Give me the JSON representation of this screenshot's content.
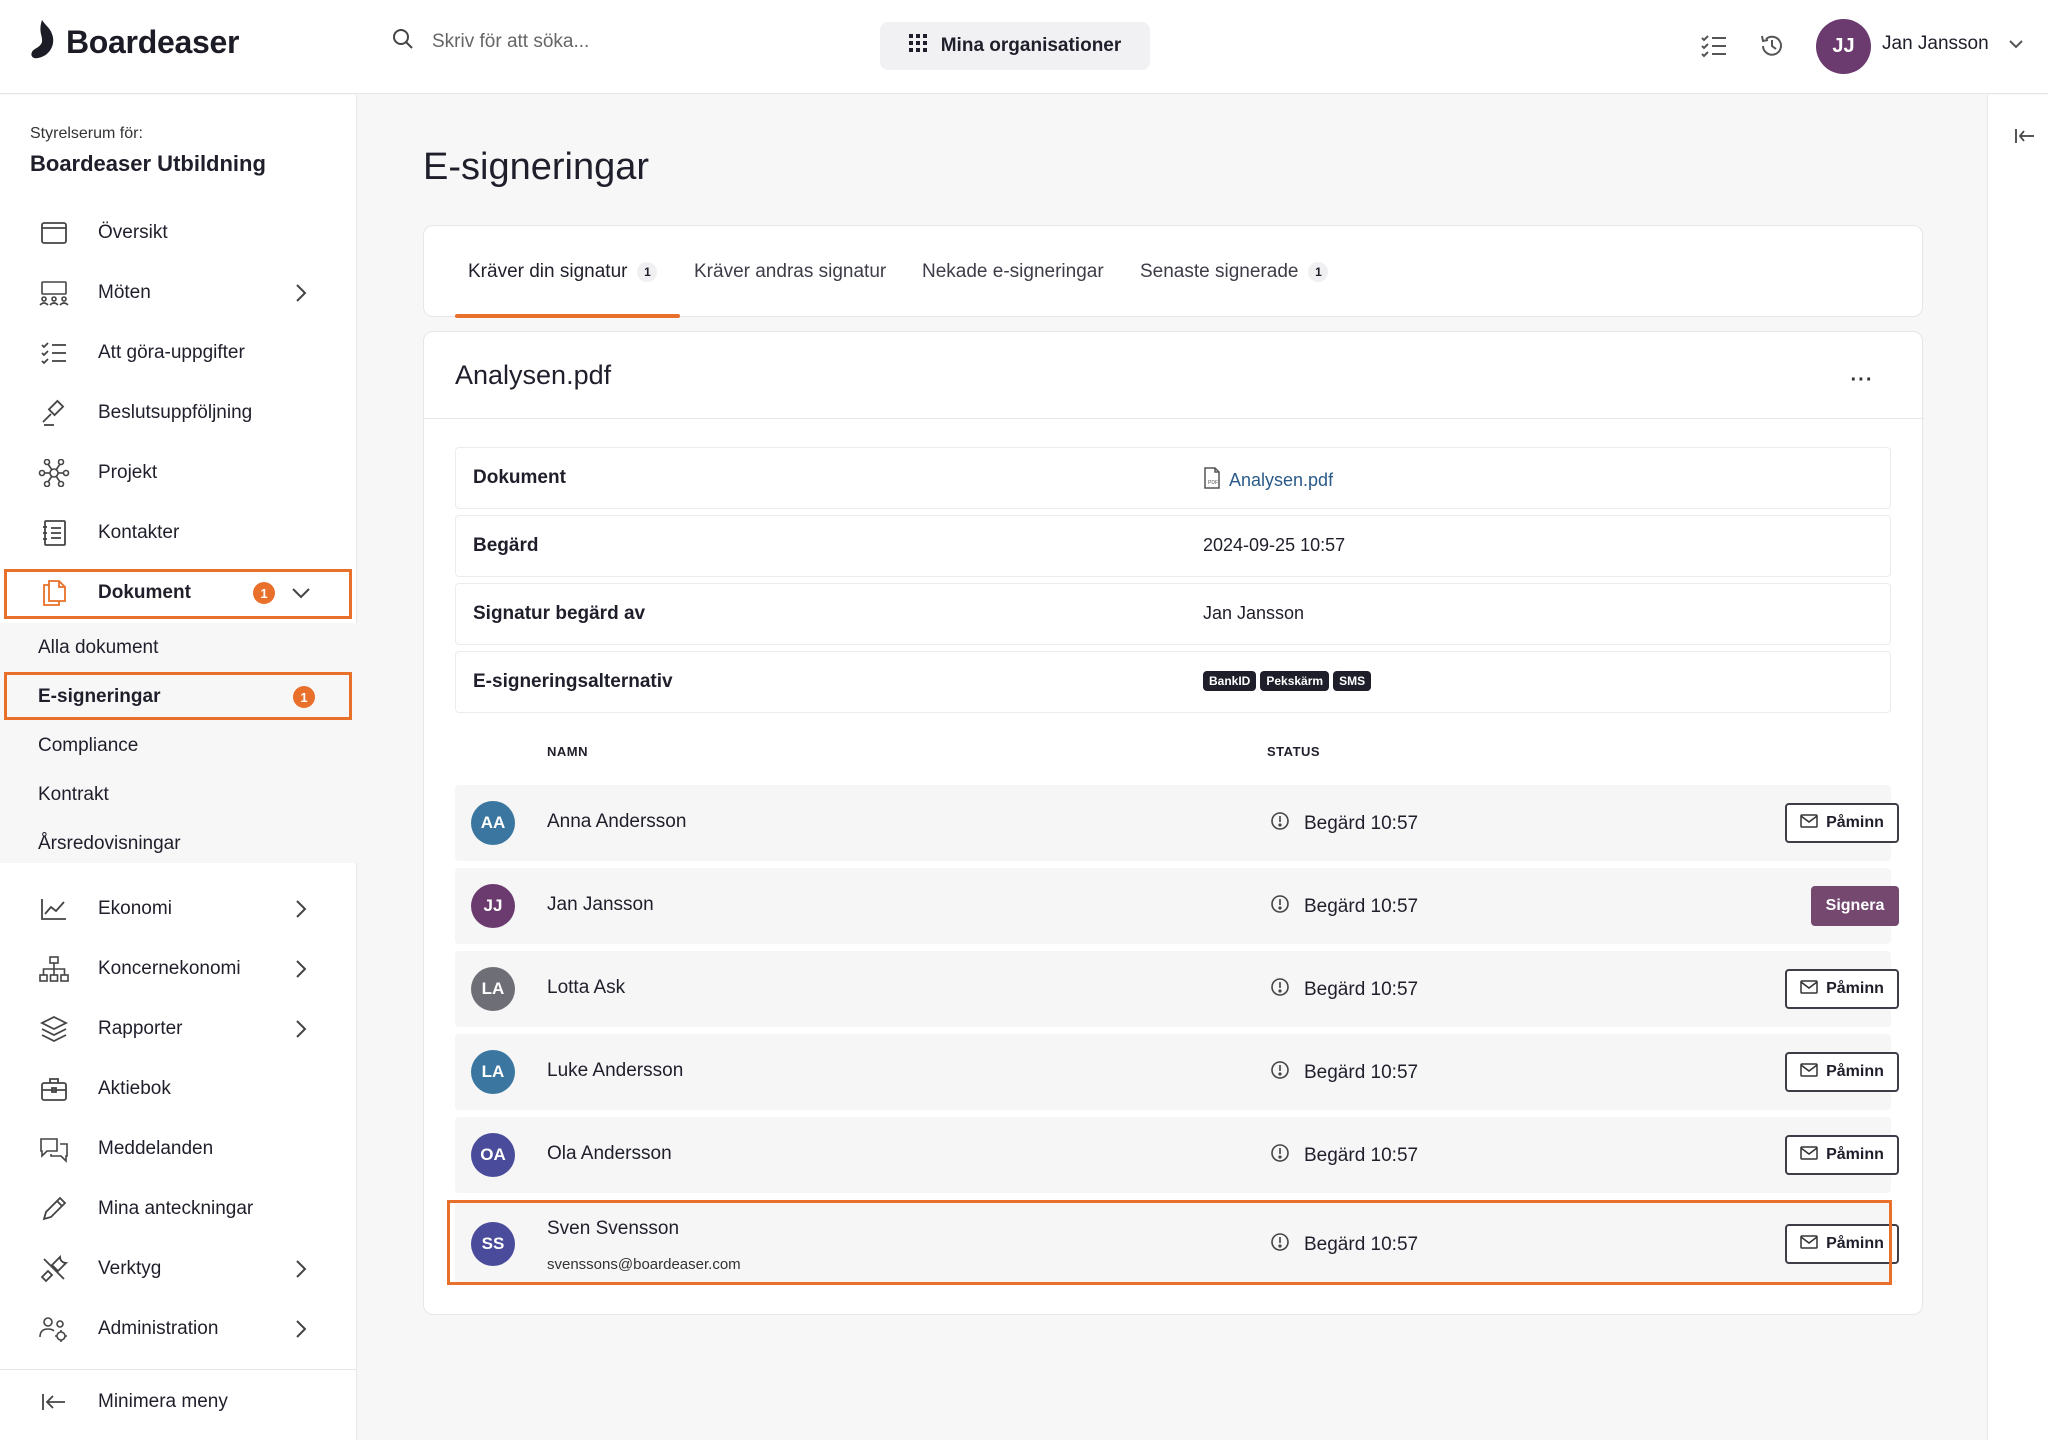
{
  "app": {
    "name": "Boardeaser"
  },
  "header": {
    "search_placeholder": "Skriv för att söka...",
    "org_button": "Mina organisationer",
    "user": {
      "initials": "JJ",
      "name": "Jan Jansson"
    }
  },
  "sidebar": {
    "org_label": "Styrelserum för:",
    "org_name": "Boardeaser Utbildning",
    "items": [
      {
        "label": "Översikt"
      },
      {
        "label": "Möten"
      },
      {
        "label": "Att göra-uppgifter"
      },
      {
        "label": "Beslutsuppföljning"
      },
      {
        "label": "Projekt"
      },
      {
        "label": "Kontakter"
      },
      {
        "label": "Dokument",
        "badge": "1"
      },
      {
        "label": "Ekonomi"
      },
      {
        "label": "Koncernekonomi"
      },
      {
        "label": "Rapporter"
      },
      {
        "label": "Aktiebok"
      },
      {
        "label": "Meddelanden"
      },
      {
        "label": "Mina anteckningar"
      },
      {
        "label": "Verktyg"
      },
      {
        "label": "Administration"
      }
    ],
    "sub_items": [
      {
        "label": "Alla dokument"
      },
      {
        "label": "E-signeringar",
        "badge": "1"
      },
      {
        "label": "Compliance"
      },
      {
        "label": "Kontrakt"
      },
      {
        "label": "Årsredovisningar"
      }
    ],
    "minimize": "Minimera meny"
  },
  "main": {
    "title": "E-signeringar",
    "tabs": [
      {
        "label": "Kräver din signatur",
        "count": "1"
      },
      {
        "label": "Kräver andras signatur"
      },
      {
        "label": "Nekade e-signeringar"
      },
      {
        "label": "Senaste signerade",
        "count": "1"
      }
    ],
    "document": {
      "title": "Analysen.pdf",
      "more": "···",
      "info": [
        {
          "key": "Dokument",
          "value": "Analysen.pdf"
        },
        {
          "key": "Begärd",
          "value": "2024-09-25 10:57"
        },
        {
          "key": "Signatur begärd av",
          "value": "Jan Jansson"
        },
        {
          "key": "E-signeringsalternativ",
          "options": [
            "BankID",
            "Pekskärm",
            "SMS"
          ]
        }
      ],
      "columns": {
        "name": "NAMN",
        "status": "STATUS"
      },
      "signers": [
        {
          "initials": "AA",
          "name": "Anna Andersson",
          "status": "Begärd 10:57",
          "action": "Påminn",
          "color": "#3a76a0"
        },
        {
          "initials": "JJ",
          "name": "Jan Jansson",
          "status": "Begärd 10:57",
          "action": "Signera",
          "color": "#6b3a6e"
        },
        {
          "initials": "LA",
          "name": "Lotta Ask",
          "status": "Begärd 10:57",
          "action": "Påminn",
          "color": "#6e6e76"
        },
        {
          "initials": "LA",
          "name": "Luke Andersson",
          "status": "Begärd 10:57",
          "action": "Påminn",
          "color": "#3a76a0"
        },
        {
          "initials": "OA",
          "name": "Ola Andersson",
          "status": "Begärd 10:57",
          "action": "Påminn",
          "color": "#4a4b9a"
        },
        {
          "initials": "SS",
          "name": "Sven Svensson",
          "email": "svenssons@boardeaser.com",
          "status": "Begärd 10:57",
          "action": "Påminn",
          "color": "#4a4b9a"
        }
      ]
    }
  },
  "colors": {
    "accent": "#e8702a",
    "brand": "#74486f"
  }
}
